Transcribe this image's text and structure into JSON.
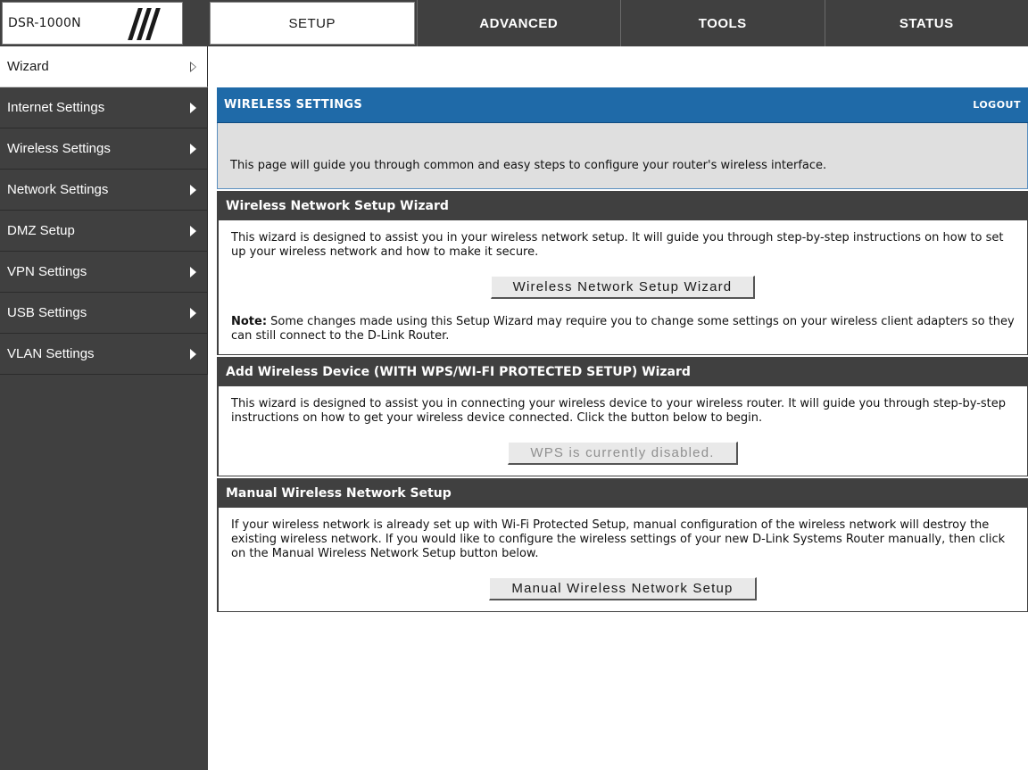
{
  "header": {
    "model": "DSR-1000N",
    "tabs": [
      "SETUP",
      "ADVANCED",
      "TOOLS",
      "STATUS"
    ],
    "active_tab": "SETUP"
  },
  "sidebar": {
    "items": [
      {
        "label": "Wizard",
        "active": true
      },
      {
        "label": "Internet Settings"
      },
      {
        "label": "Wireless Settings"
      },
      {
        "label": "Network Settings"
      },
      {
        "label": "DMZ Setup"
      },
      {
        "label": "VPN Settings"
      },
      {
        "label": "USB Settings"
      },
      {
        "label": "VLAN Settings"
      }
    ]
  },
  "page": {
    "title": "WIRELESS SETTINGS",
    "logout": "LOGOUT",
    "intro": "This page will guide you through common and easy steps to configure your router's wireless interface."
  },
  "sections": {
    "wizard": {
      "title": "Wireless Network Setup Wizard",
      "body": "This wizard is designed to assist you in your wireless network setup. It will guide you through step-by-step instructions on how to set up your wireless network and how to make it secure.",
      "button": "Wireless Network Setup Wizard",
      "note_label": "Note:",
      "note_text": " Some changes made using this Setup Wizard may require you to change some settings on your wireless client adapters so they can still connect to the D-Link Router."
    },
    "wps": {
      "title": "Add Wireless Device (WITH WPS/WI-FI PROTECTED SETUP) Wizard",
      "body": "This wizard is designed to assist you in connecting your wireless device to your wireless router. It will guide you through step-by-step instructions on how to get your wireless device connected. Click the button below to begin.",
      "button": "WPS is currently disabled."
    },
    "manual": {
      "title": "Manual Wireless Network Setup",
      "body": "If your wireless network is already set up with Wi-Fi Protected Setup, manual configuration of the wireless network will destroy the existing wireless network. If you would like to configure the wireless settings of your new D-Link Systems Router manually, then click on the Manual Wireless Network Setup button below.",
      "button": "Manual Wireless Network Setup"
    }
  }
}
